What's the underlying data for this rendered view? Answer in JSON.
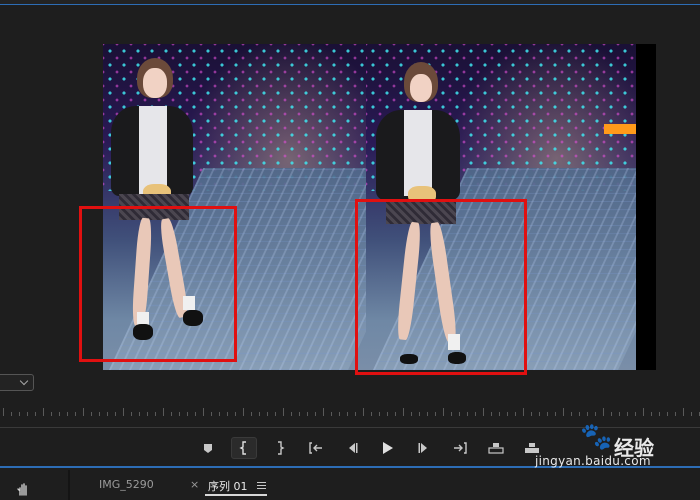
{
  "monitor": {
    "zoom_dropdown_value": ""
  },
  "transport": {
    "controls": [
      {
        "name": "add-marker-button",
        "glyph": "⬟"
      },
      {
        "name": "mark-in-button",
        "glyph": "{"
      },
      {
        "name": "mark-out-button",
        "glyph": "}"
      },
      {
        "name": "go-to-in-button",
        "glyph": "{←"
      },
      {
        "name": "step-back-button",
        "glyph": "◀|"
      },
      {
        "name": "play-button",
        "glyph": "▶"
      },
      {
        "name": "step-forward-button",
        "glyph": "|▶"
      },
      {
        "name": "go-to-out-button",
        "glyph": "→}"
      },
      {
        "name": "lift-button",
        "glyph": "⎍"
      },
      {
        "name": "extract-button",
        "glyph": "⎌"
      },
      {
        "name": "export-frame-button",
        "glyph": "◫"
      },
      {
        "name": "button-editor-button",
        "glyph": "+"
      }
    ]
  },
  "tabs": [
    {
      "label": "IMG_5290",
      "active": false
    },
    {
      "label": "序列 01",
      "active": true
    }
  ],
  "tab_close_glyph": "×",
  "watermark": {
    "brand": "Baidu",
    "text": "经验",
    "url": "jingyan.baidu.com"
  },
  "colors": {
    "background": "#1e1e1e",
    "accent_blue": "#2d6db5",
    "highlight_red": "#e01010"
  }
}
